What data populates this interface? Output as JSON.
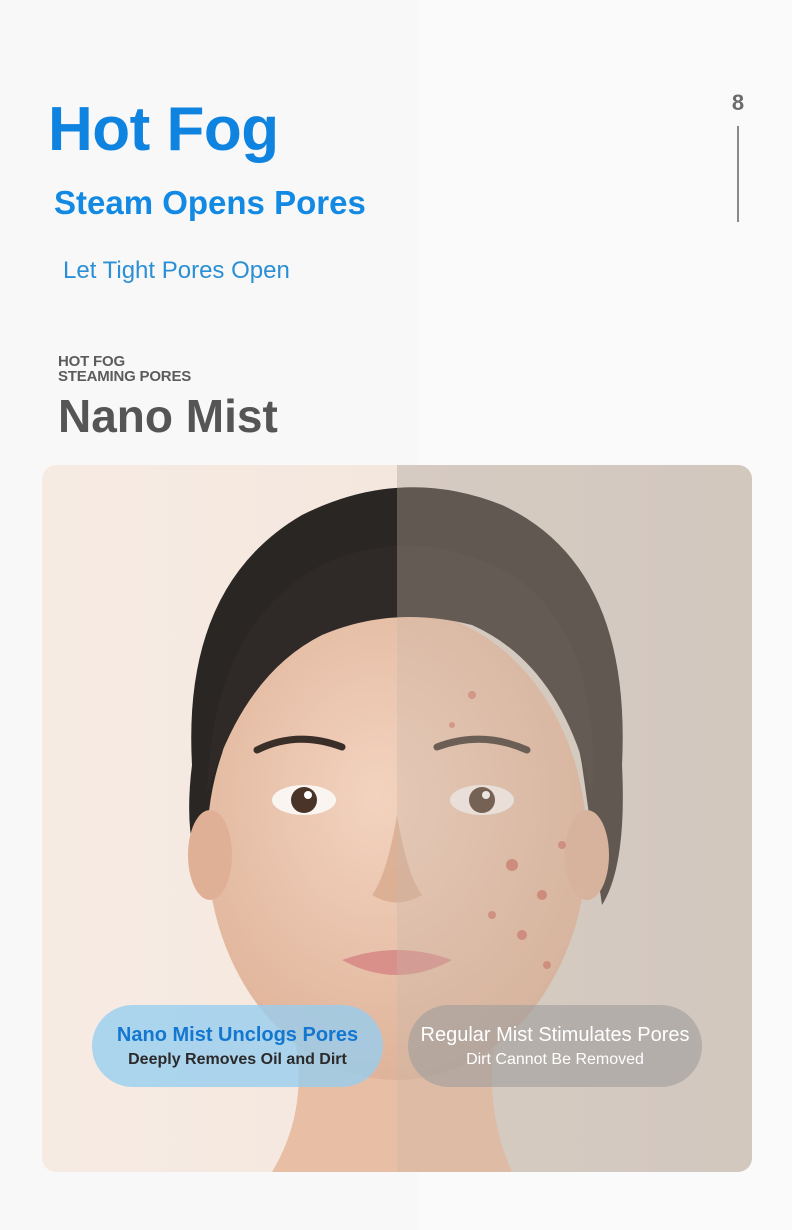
{
  "header": {
    "title": "Hot Fog",
    "subtitle": "Steam Opens Pores",
    "tagline": "Let Tight Pores Open",
    "page_number": "8"
  },
  "section": {
    "eyebrow_line1": "HOT FOG",
    "eyebrow_line2": "STEAMING PORES",
    "title": "Nano Mist"
  },
  "comparison": {
    "left": {
      "heading": "Nano Mist Unclogs Pores",
      "detail": "Deeply Removes Oil and Dirt"
    },
    "right": {
      "heading": "Regular Mist Stimulates Pores",
      "detail": "Dirt Cannot Be Removed"
    }
  },
  "colors": {
    "accent_blue": "#0f83e0",
    "text_gray": "#555555",
    "left_pill": "#96cdf0",
    "right_pill": "#a09e9c"
  }
}
